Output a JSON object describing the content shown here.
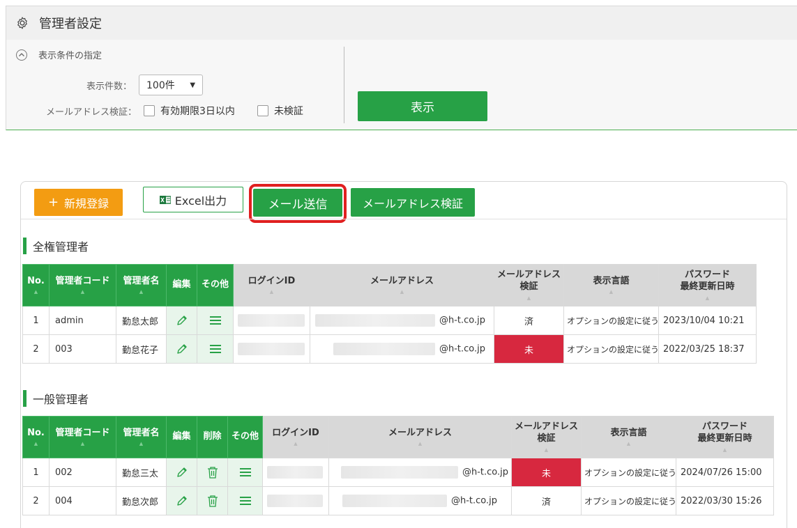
{
  "header": {
    "title": "管理者設定"
  },
  "conditions": {
    "heading": "表示条件の指定",
    "count_label": "表示件数：",
    "count_value": "100件",
    "verify_label": "メールアドレス検証：",
    "option_expiry": "有効期限3日以内",
    "option_unverified": "未検証",
    "show_button": "表示"
  },
  "toolbar": {
    "new_label": "新規登録",
    "excel_label": "Excel出力",
    "mail_label": "メール送信",
    "verify_label": "メールアドレス検証"
  },
  "full_admins": {
    "title": "全権管理者",
    "columns": {
      "no": "No.",
      "code": "管理者コード",
      "name": "管理者名",
      "edit": "編集",
      "other": "その他",
      "login": "ログインID",
      "email": "メールアドレス",
      "verify_l1": "メールアドレス",
      "verify_l2": "検証",
      "lang": "表示言語",
      "pw_l1": "パスワード",
      "pw_l2": "最終更新日時"
    },
    "rows": [
      {
        "no": "1",
        "code": "admin",
        "name": "勤怠太郎",
        "email_domain": "@h-t.co.jp",
        "verify": "済",
        "lang": "オプションの設定に従う",
        "updated": "2023/10/04 10:21"
      },
      {
        "no": "2",
        "code": "003",
        "name": "勤怠花子",
        "email_domain": "@h-t.co.jp",
        "verify": "未",
        "lang": "オプションの設定に従う",
        "updated": "2022/03/25 18:37"
      }
    ]
  },
  "general_admins": {
    "title": "一般管理者",
    "columns": {
      "no": "No.",
      "code": "管理者コード",
      "name": "管理者名",
      "edit": "編集",
      "delete": "削除",
      "other": "その他",
      "login": "ログインID",
      "email": "メールアドレス",
      "verify_l1": "メールアドレス",
      "verify_l2": "検証",
      "lang": "表示言語",
      "pw_l1": "パスワード",
      "pw_l2": "最終更新日時"
    },
    "rows": [
      {
        "no": "1",
        "code": "002",
        "name": "勤怠三太",
        "email_domain": "@h-t.co.jp",
        "verify": "未",
        "lang": "オプションの設定に従う",
        "updated": "2024/07/26 15:00"
      },
      {
        "no": "2",
        "code": "004",
        "name": "勤怠次郎",
        "email_domain": "@h-t.co.jp",
        "verify": "済",
        "lang": "オプションの設定に従う",
        "updated": "2022/03/30 15:26"
      }
    ]
  },
  "colors": {
    "green": "#27a146",
    "orange": "#f39c12",
    "red": "#d7283f",
    "highlight": "#e02020"
  }
}
